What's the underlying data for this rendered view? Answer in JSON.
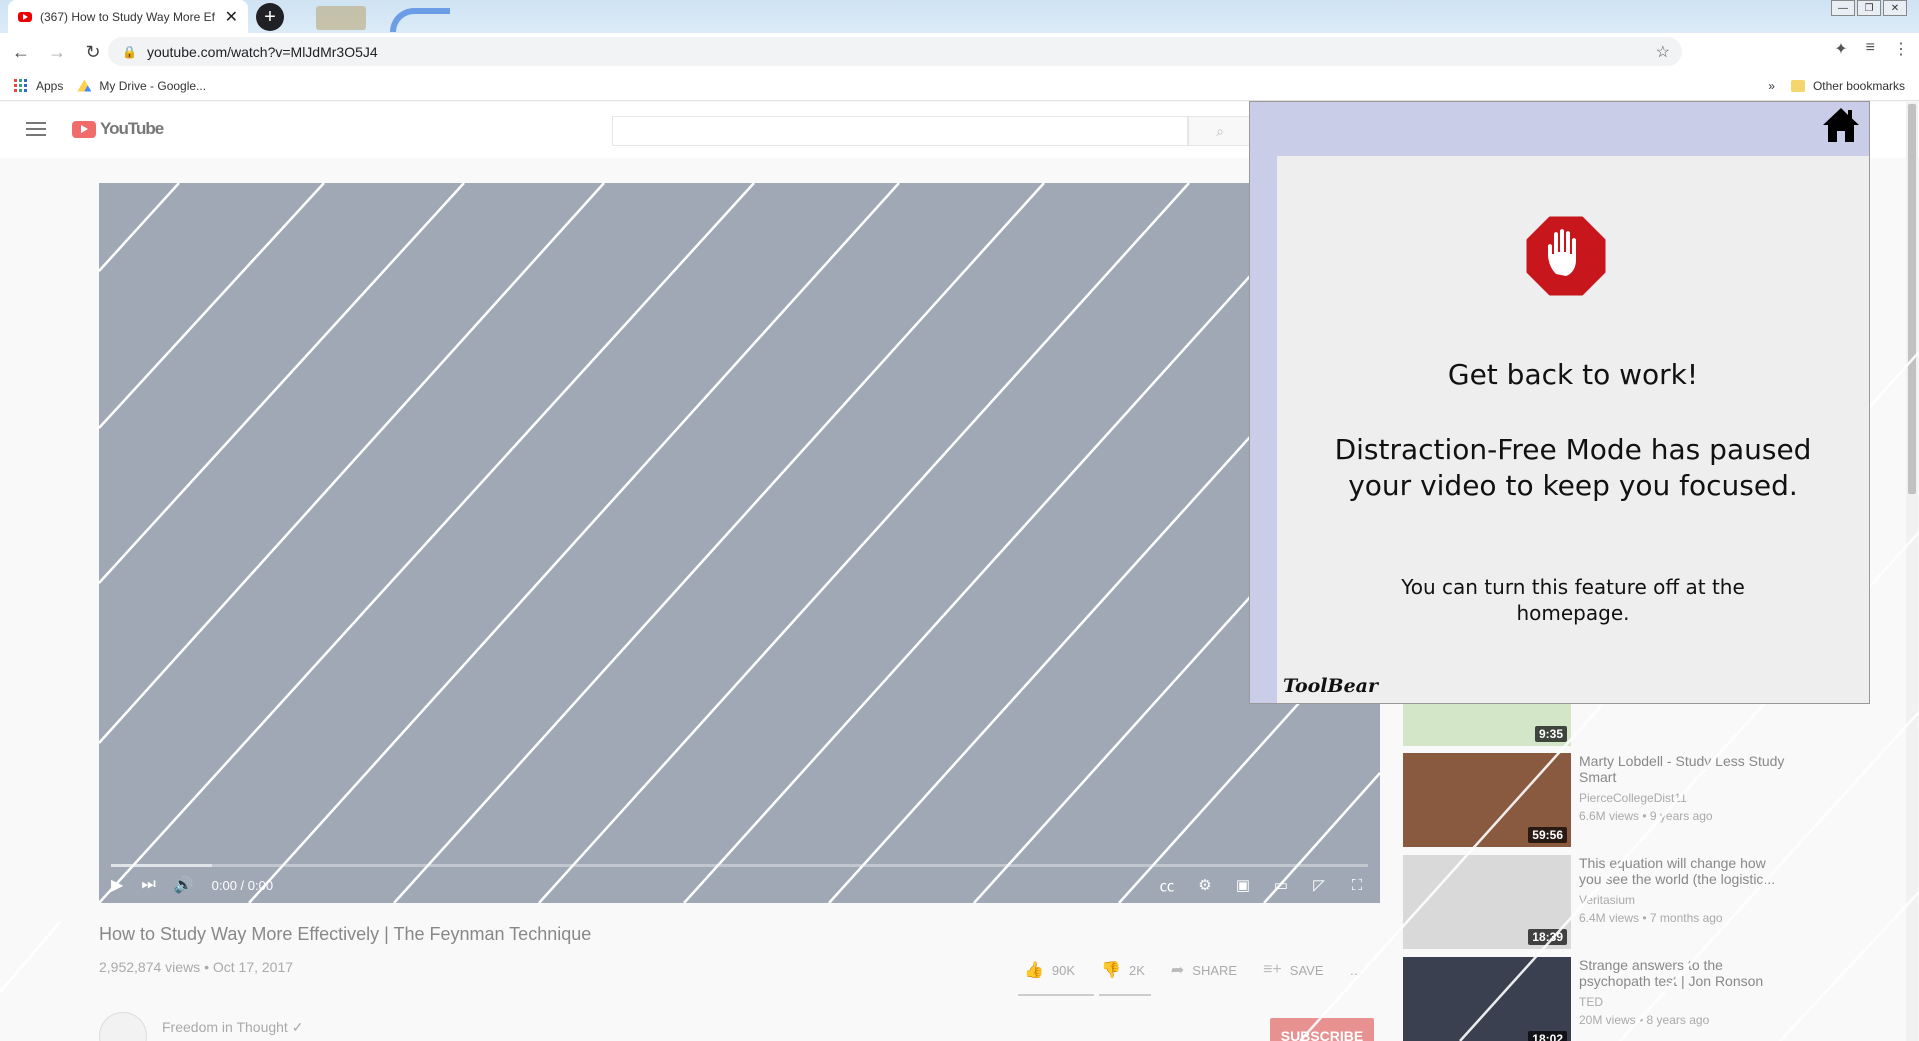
{
  "browser": {
    "tab_title": "(367) How to Study Way More Ef",
    "tab_close": "✕",
    "new_tab": "+",
    "url": "youtube.com/watch?v=MlJdMr3O5J4",
    "bookmarks": {
      "apps": "Apps",
      "drive": "My Drive - Google...",
      "overflow": "»",
      "other": "Other bookmarks"
    }
  },
  "youtube": {
    "logo_text": "YouTube",
    "player": {
      "time": "0:00 / 0:00"
    },
    "video": {
      "title": "How to Study Way More Effectively | The Feynman Technique",
      "meta": "2,952,874 views • Oct 17, 2017",
      "likes": "90K",
      "dislikes": "2K",
      "share": "SHARE",
      "save": "SAVE",
      "more": "…"
    },
    "channel": {
      "name": "Freedom in Thought",
      "verified": "✓",
      "subscribe": "SUBSCRIBE"
    },
    "related": [
      {
        "duration": "9:35"
      },
      {
        "title": "Marty Lobdell - Study Less Study Smart",
        "channel": "PierceCollegeDist11",
        "stats": "6.6M views • 9 years ago",
        "duration": "59:56"
      },
      {
        "title": "This equation will change how you see the world (the logistic...",
        "channel": "Veritasium",
        "stats": "6.4M views • 7 months ago",
        "duration": "18:39"
      },
      {
        "title": "Strange answers to the psychopath test | Jon Ronson",
        "channel": "TED",
        "stats": "20M views • 8 years ago",
        "duration": "18:02"
      }
    ]
  },
  "toolbear": {
    "heading": "Get back to work!",
    "message": "Distraction-Free Mode has paused your video to keep you focused.",
    "note": "You can turn this feature off at the homepage.",
    "brand": "ToolBear",
    "colors": {
      "panel": "#c9cde8",
      "card": "#eeeeee",
      "stop": "#c8161d"
    }
  }
}
